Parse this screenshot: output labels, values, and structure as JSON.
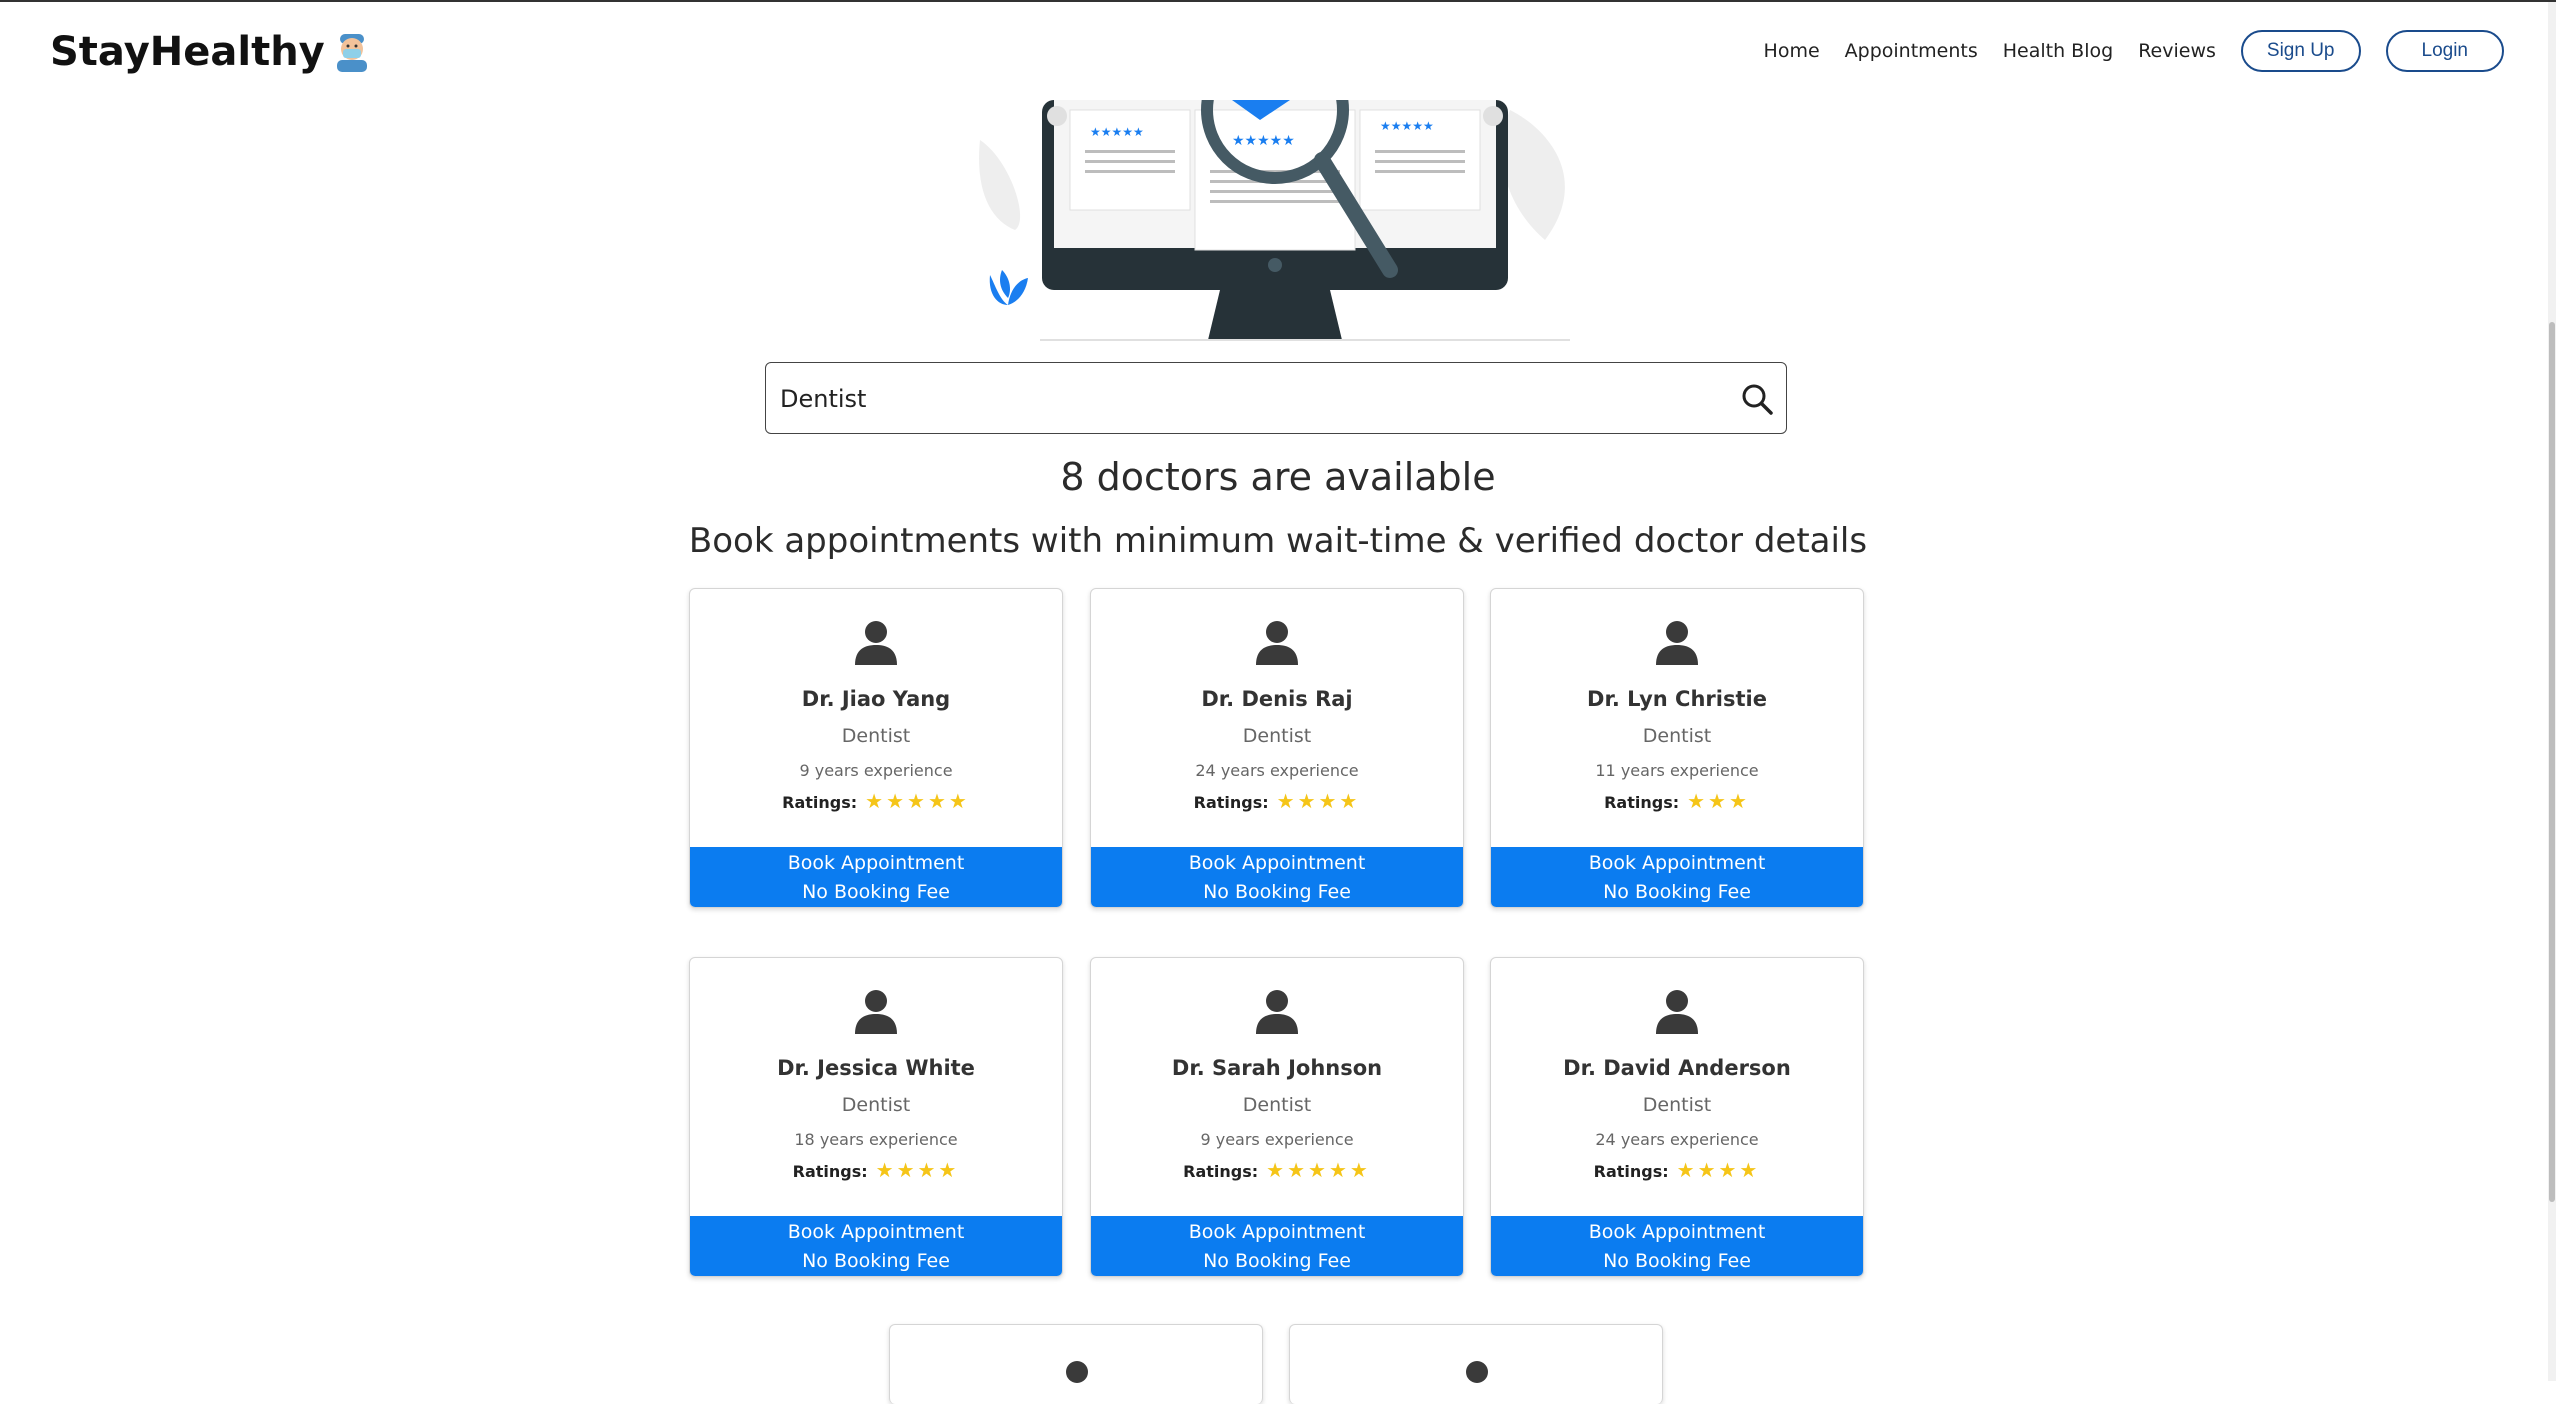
{
  "app": {
    "logo": "StayHealthy",
    "mascot_icon": "doctor-mask-emoji"
  },
  "nav": {
    "home": "Home",
    "appointments": "Appointments",
    "health_blog": "Health Blog",
    "reviews": "Reviews",
    "sign_up": "Sign Up",
    "login": "Login"
  },
  "search": {
    "value": "Dentist",
    "icon": "search-icon"
  },
  "results": {
    "count_text": "8 doctors are available",
    "subtitle": "Book appointments with minimum wait-time & verified doctor details"
  },
  "rating_label": "Ratings:",
  "doctors": [
    {
      "name": "Dr. Jiao Yang",
      "specialty": "Dentist",
      "experience": "9 years experience",
      "stars": 5,
      "book_line1": "Book Appointment",
      "book_line2": "No Booking Fee"
    },
    {
      "name": "Dr. Denis Raj",
      "specialty": "Dentist",
      "experience": "24 years experience",
      "stars": 4,
      "book_line1": "Book Appointment",
      "book_line2": "No Booking Fee"
    },
    {
      "name": "Dr. Lyn Christie",
      "specialty": "Dentist",
      "experience": "11 years experience",
      "stars": 3,
      "book_line1": "Book Appointment",
      "book_line2": "No Booking Fee"
    },
    {
      "name": "Dr. Jessica White",
      "specialty": "Dentist",
      "experience": "18 years experience",
      "stars": 4,
      "book_line1": "Book Appointment",
      "book_line2": "No Booking Fee"
    },
    {
      "name": "Dr. Sarah Johnson",
      "specialty": "Dentist",
      "experience": "9 years experience",
      "stars": 5,
      "book_line1": "Book Appointment",
      "book_line2": "No Booking Fee"
    },
    {
      "name": "Dr. David Anderson",
      "specialty": "Dentist",
      "experience": "24 years experience",
      "stars": 4,
      "book_line1": "Book Appointment",
      "book_line2": "No Booking Fee"
    }
  ],
  "colors": {
    "accent": "#0b7cf0",
    "star": "#f5c518",
    "nav_button_border": "#1a4b8c"
  }
}
